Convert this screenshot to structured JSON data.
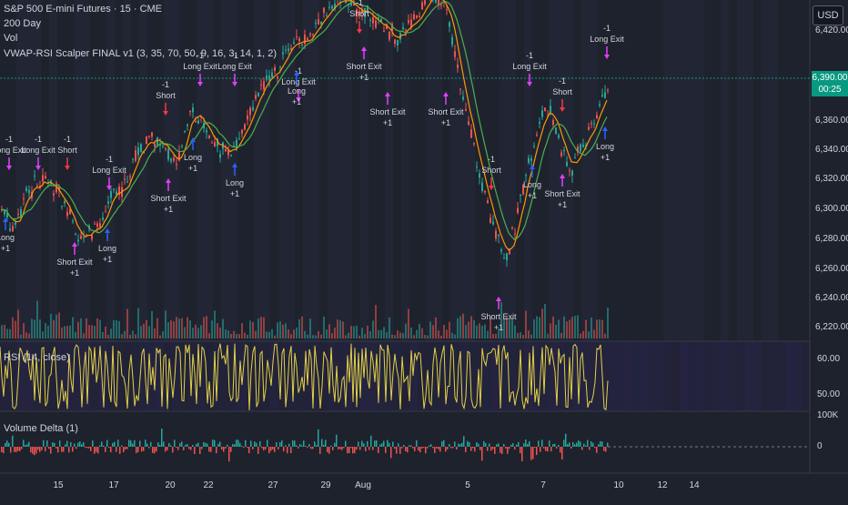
{
  "header": {
    "symbol": "S&P 500 E-mini Futures · 15 · CME",
    "indicator_1": "200 Day",
    "indicator_2": "Vol",
    "indicator_3": "VWAP-RSI Scalper FINAL v1 (3, 35, 70, 50, 9, 16, 3, 14, 1, 2)"
  },
  "currency_button": "USD",
  "last_price": {
    "value": "6,390.00",
    "countdown": "00:25",
    "color": "#089981"
  },
  "price_axis": [
    "6,420.00",
    "6,400.00",
    "6,380.00",
    "6,360.00",
    "6,340.00",
    "6,320.00",
    "6,300.00",
    "6,280.00",
    "6,260.00",
    "6,240.00",
    "6,220.00"
  ],
  "rsi_panel": {
    "title": "RSI (14, close)",
    "ticks": [
      "60.00",
      "50.00"
    ],
    "bg_color": "#2a2550",
    "line_color": "#e2d04a"
  },
  "volume_delta_panel": {
    "title": "Volume Delta (1)",
    "ticks": [
      "100K",
      "0"
    ]
  },
  "time_axis": [
    "15",
    "17",
    "20",
    "22",
    "27",
    "29",
    "Aug",
    "5",
    "7",
    "10",
    "12",
    "14"
  ],
  "signals": [
    {
      "text": "Long Exit",
      "sub": "-1"
    },
    {
      "text": "Short",
      "sub": "-1"
    },
    {
      "text": "Short Exit",
      "sub": "+1"
    },
    {
      "text": "Long",
      "sub": "+1"
    }
  ],
  "colors": {
    "bull": "#26a69a",
    "bear": "#ef5350",
    "signal_magenta": "#e040fb",
    "signal_blue": "#2962ff",
    "signal_red": "#f23645",
    "ema_orange": "#ff9800",
    "ema_green": "#4caf50"
  }
}
